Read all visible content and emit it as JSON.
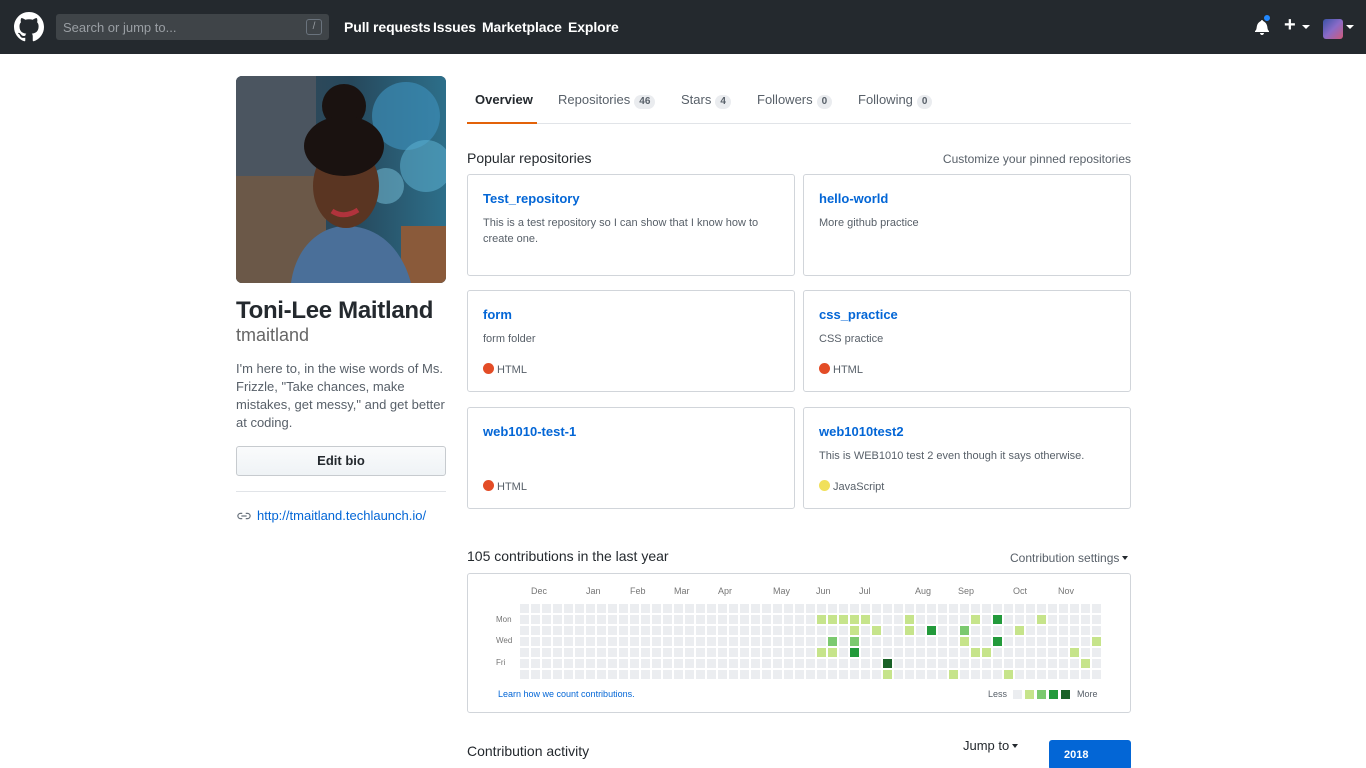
{
  "header": {
    "search_placeholder": "Search or jump to...",
    "search_shortcut": "/",
    "nav": [
      "Pull requests",
      "Issues",
      "Marketplace",
      "Explore"
    ],
    "plus_label": "+"
  },
  "profile": {
    "full_name": "Toni-Lee Maitland",
    "username": "tmaitland",
    "bio": "I'm here to, in the wise words of Ms. Frizzle, \"Take chances, make mistakes, get messy,\" and get better at coding.",
    "edit_bio_label": "Edit bio",
    "website": "http://tmaitland.techlaunch.io/"
  },
  "tabs": [
    {
      "label": "Overview",
      "count": ""
    },
    {
      "label": "Repositories",
      "count": "46"
    },
    {
      "label": "Stars",
      "count": "4"
    },
    {
      "label": "Followers",
      "count": "0"
    },
    {
      "label": "Following",
      "count": "0"
    }
  ],
  "popular": {
    "title": "Popular repositories",
    "customize_label": "Customize your pinned repositories",
    "repos": [
      {
        "name": "Test_repository",
        "description": "This is a test repository so I can show that I know how to create one.",
        "language": "",
        "lang_color": ""
      },
      {
        "name": "hello-world",
        "description": "More github practice",
        "language": "",
        "lang_color": ""
      },
      {
        "name": "form",
        "description": "form folder",
        "language": "HTML",
        "lang_color": "#e34c26"
      },
      {
        "name": "css_practice",
        "description": "CSS practice",
        "language": "HTML",
        "lang_color": "#e34c26"
      },
      {
        "name": "web1010-test-1",
        "description": "",
        "language": "HTML",
        "lang_color": "#e34c26"
      },
      {
        "name": "web1010test2",
        "description": "This is WEB1010 test 2 even though it says otherwise.",
        "language": "JavaScript",
        "lang_color": "#f1e05a"
      }
    ]
  },
  "contributions": {
    "title": "105 contributions in the last year",
    "settings_label": "Contribution settings",
    "months": [
      "Dec",
      "Jan",
      "Feb",
      "Mar",
      "Apr",
      "May",
      "Jun",
      "Jul",
      "Aug",
      "Sep",
      "Oct",
      "Nov"
    ],
    "days": [
      "Mon",
      "Wed",
      "Fri"
    ],
    "learn_label": "Learn how we count contributions.",
    "less_label": "Less",
    "more_label": "More",
    "level_colors": [
      "#ebedf0",
      "#c6e48b",
      "#7bc96f",
      "#239a3b",
      "#196127"
    ],
    "weeks": 53,
    "active_cells": [
      [
        27,
        1,
        1
      ],
      [
        28,
        1,
        1
      ],
      [
        29,
        1,
        1
      ],
      [
        30,
        1,
        1
      ],
      [
        31,
        1,
        1
      ],
      [
        35,
        1,
        1
      ],
      [
        41,
        1,
        1
      ],
      [
        43,
        1,
        3
      ],
      [
        47,
        1,
        1
      ],
      [
        30,
        2,
        1
      ],
      [
        32,
        2,
        1
      ],
      [
        35,
        2,
        1
      ],
      [
        37,
        2,
        3
      ],
      [
        40,
        2,
        2
      ],
      [
        45,
        2,
        1
      ],
      [
        28,
        3,
        2
      ],
      [
        30,
        3,
        2
      ],
      [
        40,
        3,
        1
      ],
      [
        43,
        3,
        3
      ],
      [
        52,
        3,
        1
      ],
      [
        27,
        4,
        1
      ],
      [
        28,
        4,
        1
      ],
      [
        30,
        4,
        3
      ],
      [
        41,
        4,
        1
      ],
      [
        42,
        4,
        1
      ],
      [
        50,
        4,
        1
      ],
      [
        33,
        5,
        4
      ],
      [
        51,
        5,
        1
      ],
      [
        33,
        6,
        1
      ],
      [
        39,
        6,
        1
      ],
      [
        44,
        6,
        1
      ]
    ]
  },
  "activity": {
    "title": "Contribution activity",
    "jump_label": "Jump to",
    "year": "2018"
  }
}
